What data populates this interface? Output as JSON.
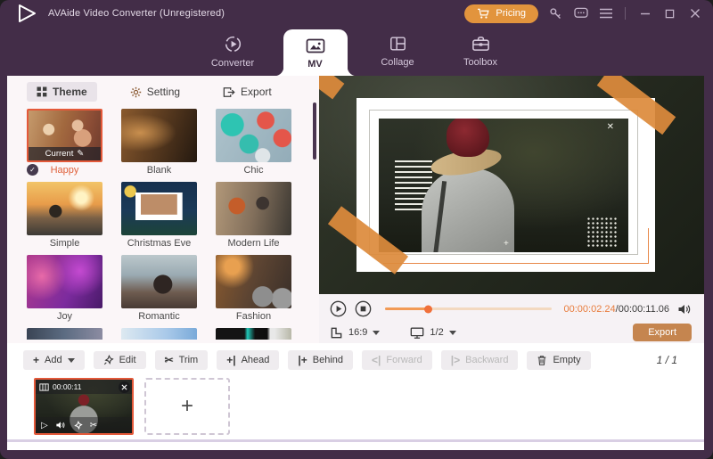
{
  "titlebar": {
    "title": "AVAide Video Converter (Unregistered)",
    "pricing": "Pricing"
  },
  "nav": {
    "tabs": [
      {
        "label": "Converter"
      },
      {
        "label": "MV"
      },
      {
        "label": "Collage"
      },
      {
        "label": "Toolbox"
      }
    ]
  },
  "panel": {
    "tabs": [
      {
        "label": "Theme"
      },
      {
        "label": "Setting"
      },
      {
        "label": "Export"
      }
    ],
    "current_badge": "Current",
    "themes": [
      {
        "name": "Happy"
      },
      {
        "name": "Blank"
      },
      {
        "name": "Chic"
      },
      {
        "name": "Simple"
      },
      {
        "name": "Christmas Eve"
      },
      {
        "name": "Modern Life"
      },
      {
        "name": "Joy"
      },
      {
        "name": "Romantic"
      },
      {
        "name": "Fashion"
      }
    ]
  },
  "player": {
    "current_time": "00:00:02.24",
    "time_separator": "/",
    "total_time": "00:00:11.06",
    "progress_percent": 26,
    "aspect_ratio": "16:9",
    "display_mode": "1/2",
    "export": "Export"
  },
  "toolbar": {
    "add": "Add",
    "edit": "Edit",
    "trim": "Trim",
    "ahead": "Ahead",
    "behind": "Behind",
    "forward": "Forward",
    "backward": "Backward",
    "empty": "Empty",
    "page": "1 / 1"
  },
  "timeline": {
    "clip_duration": "00:00:11"
  },
  "icons": {
    "check": "✓",
    "pencil": "✎",
    "scissors": "✂",
    "play_outline": "▷",
    "plus": "+",
    "ahead_glyph": "+|",
    "behind_glyph": "|+",
    "forward_glyph": "<|",
    "backward_glyph": "|>",
    "x_mark": "✕",
    "plus_mark": "+"
  },
  "colors": {
    "titlebar_purple": "#432d48",
    "accent_orange": "#e2943d",
    "selection_orange": "#e4593a",
    "progress_orange": "#f0703a",
    "export_brown": "#c5854f"
  }
}
